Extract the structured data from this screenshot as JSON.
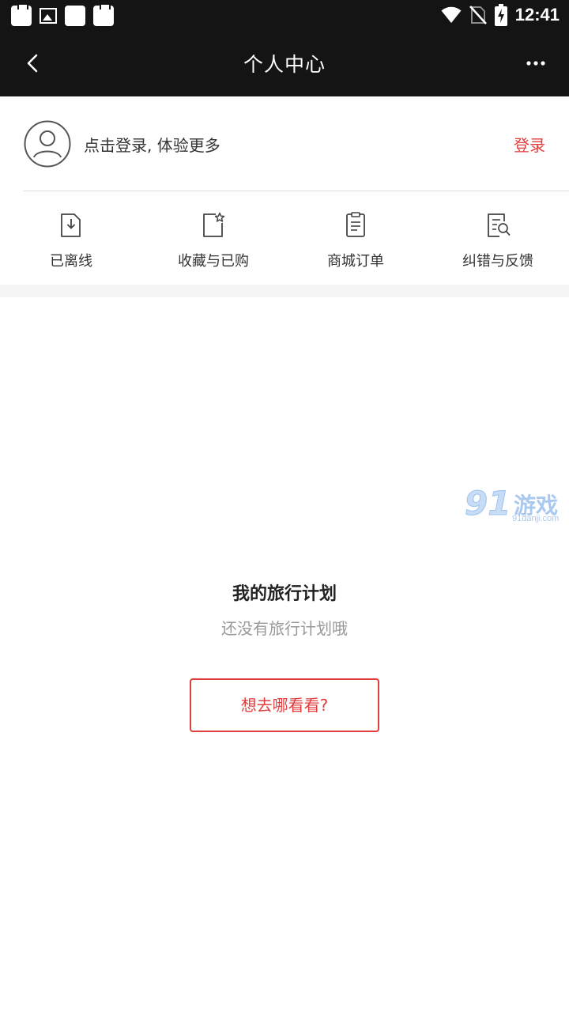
{
  "status_bar": {
    "time": "12:41",
    "left_icons": [
      "clipboard-icon",
      "image-icon",
      "app-icon",
      "clipboard-icon"
    ],
    "right_icons": [
      "wifi-icon",
      "no-sim-icon",
      "battery-charging-icon"
    ]
  },
  "app_bar": {
    "title": "个人中心",
    "back_icon": "chevron-left-icon",
    "more_icon": "more-horizontal-icon"
  },
  "profile": {
    "prompt": "点击登录, 体验更多",
    "login_label": "登录",
    "avatar_icon": "user-avatar-icon"
  },
  "quick_actions": [
    {
      "label": "已离线",
      "icon": "offline-download-icon"
    },
    {
      "label": "收藏与已购",
      "icon": "favorite-star-icon"
    },
    {
      "label": "商城订单",
      "icon": "order-list-icon"
    },
    {
      "label": "纠错与反馈",
      "icon": "feedback-search-icon"
    }
  ],
  "watermark": {
    "number": "91",
    "text": "游戏",
    "url": "91danji.com"
  },
  "travel_plan": {
    "title": "我的旅行计划",
    "empty_text": "还没有旅行计划哦",
    "cta_label": "想去哪看看?"
  },
  "colors": {
    "accent": "#e23d3d",
    "header_bg": "#141414",
    "watermark": "#a9c9f0"
  }
}
